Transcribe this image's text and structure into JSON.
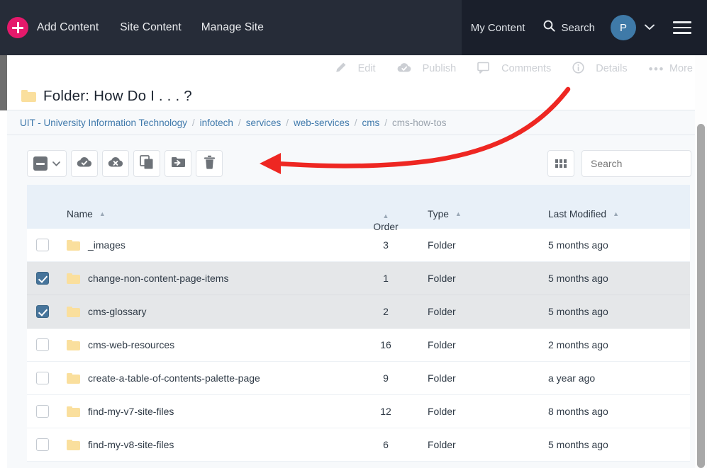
{
  "topnav": {
    "add_content_label": "Add Content",
    "site_content_label": "Site Content",
    "manage_site_label": "Manage Site",
    "my_content_label": "My Content",
    "search_label": "Search",
    "avatar_initial": "P",
    "plus_icon": "plus-icon",
    "search_icon": "search-icon",
    "chevron_icon": "chevron-down-icon",
    "menu_icon": "hamburger-icon",
    "brand_accent": "#e5196b",
    "bar_left_color": "#262c38",
    "bar_right_color": "#1a1f2b"
  },
  "actionbar": {
    "edit_label": "Edit",
    "publish_label": "Publish",
    "comments_label": "Comments",
    "details_label": "Details",
    "more_label": "More",
    "disabled_color": "#cccfd4"
  },
  "title": {
    "text": "Folder: How Do I . . . ?",
    "icon": "folder-icon"
  },
  "breadcrumb": {
    "items": [
      {
        "label": "UIT - University Information Technology",
        "current": false
      },
      {
        "label": "infotech",
        "current": false
      },
      {
        "label": "services",
        "current": false
      },
      {
        "label": "web-services",
        "current": false
      },
      {
        "label": "cms",
        "current": false
      },
      {
        "label": "cms-how-tos",
        "current": true
      }
    ],
    "separator": "/"
  },
  "toolbar": {
    "select_all_icon": "indeterminate-checkbox-icon",
    "select_all_chevron": "chevron-down-icon",
    "publish_icon": "cloud-check-icon",
    "unpublish_icon": "cloud-x-icon",
    "copy_icon": "copy-icon",
    "move_icon": "move-to-folder-icon",
    "delete_icon": "trash-icon"
  },
  "rightcontrols": {
    "columns_icon": "grid-columns-icon",
    "search_placeholder": "Search",
    "search_value": ""
  },
  "table": {
    "columns": [
      {
        "key": "check",
        "label": ""
      },
      {
        "key": "name",
        "label": "Name",
        "sorted": true
      },
      {
        "key": "order",
        "label": "Order",
        "sorted": true
      },
      {
        "key": "type",
        "label": "Type",
        "sorted": true
      },
      {
        "key": "modified",
        "label": "Last Modified",
        "sorted": true
      }
    ],
    "sort_caret": "▲",
    "rows": [
      {
        "name": "_images",
        "order": "3",
        "type": "Folder",
        "modified": "5 months ago",
        "selected": false
      },
      {
        "name": "change-non-content-page-items",
        "order": "1",
        "type": "Folder",
        "modified": "5 months ago",
        "selected": true
      },
      {
        "name": "cms-glossary",
        "order": "2",
        "type": "Folder",
        "modified": "5 months ago",
        "selected": true
      },
      {
        "name": "cms-web-resources",
        "order": "16",
        "type": "Folder",
        "modified": "2 months ago",
        "selected": false
      },
      {
        "name": "create-a-table-of-contents-palette-page",
        "order": "9",
        "type": "Folder",
        "modified": "a year ago",
        "selected": false
      },
      {
        "name": "find-my-v7-site-files",
        "order": "12",
        "type": "Folder",
        "modified": "8 months ago",
        "selected": false
      },
      {
        "name": "find-my-v8-site-files",
        "order": "6",
        "type": "Folder",
        "modified": "5 months ago",
        "selected": false
      }
    ],
    "header_bg": "#e8f0f8",
    "selected_row_bg": "#e5e7e9",
    "checkbox_checked_color": "#46749b",
    "folder_color": "#fadf9d"
  },
  "annotation": {
    "arrow_color": "#ee2722",
    "arrow_label": "red-curved-arrow-pointing-to-toolbar"
  }
}
